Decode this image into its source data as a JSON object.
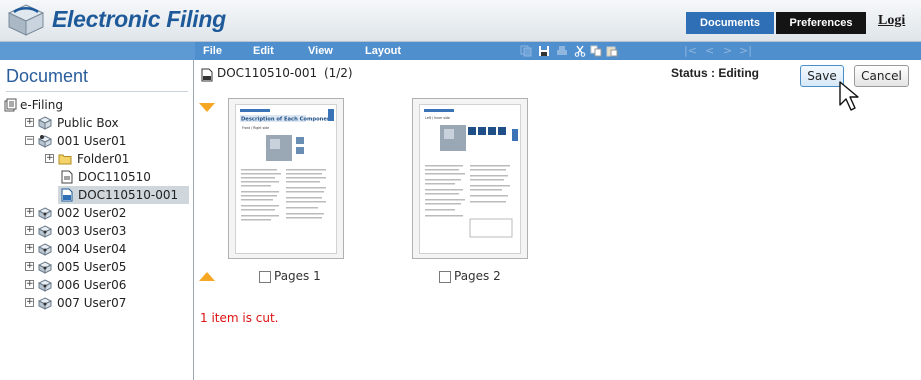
{
  "header": {
    "app_title": "Electronic Filing",
    "tabs": [
      {
        "label": "Documents",
        "active": true
      },
      {
        "label": "Preferences",
        "active": false
      }
    ],
    "logout_label": "Logi"
  },
  "menubar": {
    "items": [
      "File",
      "Edit",
      "View",
      "Layout"
    ],
    "toolbar_icons": [
      "copy-pages-icon",
      "save-icon",
      "print-icon",
      "cut-icon",
      "copy-icon",
      "paste-icon"
    ],
    "nav_arrows": [
      "|<",
      "<",
      ">",
      ">|"
    ]
  },
  "left_panel": {
    "title": "Document",
    "tree": [
      {
        "label": "e-Filing",
        "icon": "efiling-icon"
      },
      {
        "label": "Public Box",
        "icon": "box-icon"
      },
      {
        "label": "001 User01",
        "icon": "user-box-icon"
      },
      {
        "label": "Folder01",
        "icon": "folder-icon"
      },
      {
        "label": "DOC110510",
        "icon": "document-icon"
      },
      {
        "label": "DOC110510-001",
        "icon": "document-edit-icon",
        "selected": true
      },
      {
        "label": "002 User02",
        "icon": "user-box-icon"
      },
      {
        "label": "003 User03",
        "icon": "user-box-icon"
      },
      {
        "label": "004 User04",
        "icon": "user-box-icon"
      },
      {
        "label": "005 User05",
        "icon": "user-box-icon"
      },
      {
        "label": "006 User06",
        "icon": "user-box-icon"
      },
      {
        "label": "007 User07",
        "icon": "user-box-icon"
      }
    ]
  },
  "content": {
    "doc_name": "DOC110510-001",
    "page_count": "(1/2)",
    "status": "Status : Editing",
    "save_label": "Save",
    "cancel_label": "Cancel",
    "pages": [
      {
        "label": "Pages 1",
        "heading": "Description of Each Component",
        "subheading": "Front / Right side"
      },
      {
        "label": "Pages 2",
        "heading": "",
        "subheading": "Left / Inner side"
      }
    ],
    "message": "1 item is cut."
  },
  "colors": {
    "brand_blue": "#1e5a9a",
    "menubar": "#4f8fcd",
    "tab_active": "#2e6fb6",
    "tab_inactive": "#141414",
    "cut_message": "#dd1111",
    "triangle_orange": "#f5a623"
  }
}
